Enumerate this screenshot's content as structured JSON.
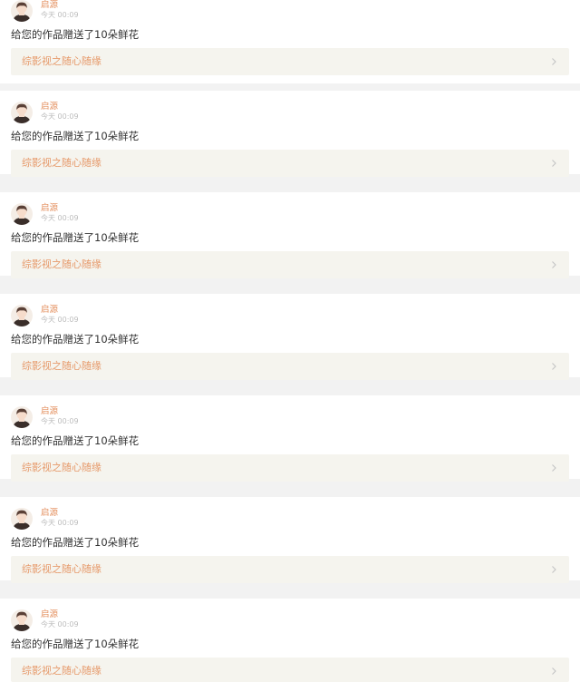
{
  "notifications": [
    {
      "username": "启源",
      "time": "今天 00:09",
      "message": "给您的作品赠送了10朵鲜花",
      "work_title": "综影视之随心随缘",
      "avatar_icon": "user-avatar-icon",
      "chevron_icon": "chevron-right-icon"
    },
    {
      "username": "启源",
      "time": "今天 00:09",
      "message": "给您的作品赠送了10朵鲜花",
      "work_title": "综影视之随心随缘",
      "avatar_icon": "user-avatar-icon",
      "chevron_icon": "chevron-right-icon"
    },
    {
      "username": "启源",
      "time": "今天 00:09",
      "message": "给您的作品赠送了10朵鲜花",
      "work_title": "综影视之随心随缘",
      "avatar_icon": "user-avatar-icon",
      "chevron_icon": "chevron-right-icon"
    },
    {
      "username": "启源",
      "time": "今天 00:09",
      "message": "给您的作品赠送了10朵鲜花",
      "work_title": "综影视之随心随缘",
      "avatar_icon": "user-avatar-icon",
      "chevron_icon": "chevron-right-icon"
    },
    {
      "username": "启源",
      "time": "今天 00:09",
      "message": "给您的作品赠送了10朵鲜花",
      "work_title": "综影视之随心随缘",
      "avatar_icon": "user-avatar-icon",
      "chevron_icon": "chevron-right-icon"
    },
    {
      "username": "启源",
      "time": "今天 00:09",
      "message": "给您的作品赠送了10朵鲜花",
      "work_title": "综影视之随心随缘",
      "avatar_icon": "user-avatar-icon",
      "chevron_icon": "chevron-right-icon"
    },
    {
      "username": "启源",
      "time": "今天 00:09",
      "message": "给您的作品赠送了10朵鲜花",
      "work_title": "综影视之随心随缘",
      "avatar_icon": "user-avatar-icon",
      "chevron_icon": "chevron-right-icon"
    }
  ],
  "colors": {
    "username": "#e38d5b",
    "work_title": "#e69a6b",
    "link_background": "#f5f4ee",
    "page_background": "#f2f2f2"
  }
}
